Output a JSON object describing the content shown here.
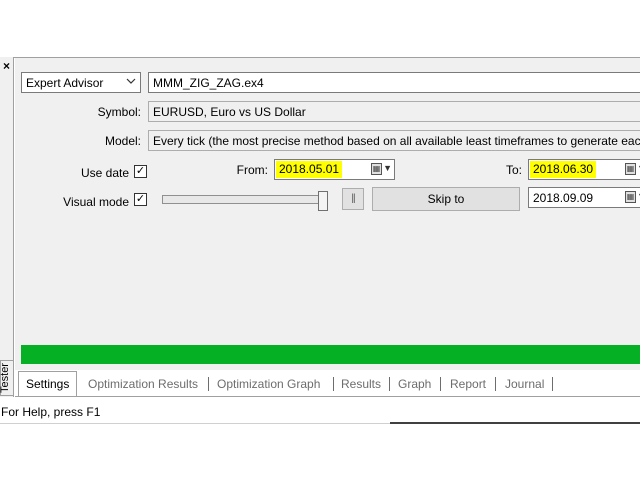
{
  "window": {
    "close_glyph": "×",
    "side_tab_label": "Tester"
  },
  "settings": {
    "ea_type": "Expert Advisor",
    "ea_file": "MMM_ZIG_ZAG.ex4",
    "symbol_label": "Symbol:",
    "symbol_value": "EURUSD, Euro vs US Dollar",
    "model_label": "Model:",
    "model_value": "Every tick (the most precise method based on all available least timeframes to generate each tick)",
    "use_date_label": "Use date",
    "use_date_checked": true,
    "from_label": "From:",
    "from_date": "2018.05.01",
    "to_label": "To:",
    "to_date": "2018.06.30",
    "visual_mode_label": "Visual mode",
    "visual_mode_checked": true,
    "visual_speed_fraction": 1.0,
    "pause_glyph": "||",
    "skip_to_label": "Skip to",
    "skip_to_date": "2018.09.09",
    "check_glyph": "✓",
    "highlight_color": "#ffff00"
  },
  "progress": {
    "fraction": 1.0,
    "color": "#06b025"
  },
  "tabs": [
    {
      "label": "Settings",
      "active": true
    },
    {
      "label": "Optimization Results",
      "active": false
    },
    {
      "label": "Optimization Graph",
      "active": false
    },
    {
      "label": "Results",
      "active": false
    },
    {
      "label": "Graph",
      "active": false
    },
    {
      "label": "Report",
      "active": false
    },
    {
      "label": "Journal",
      "active": false
    }
  ],
  "status_bar": {
    "text": "For Help, press F1"
  }
}
